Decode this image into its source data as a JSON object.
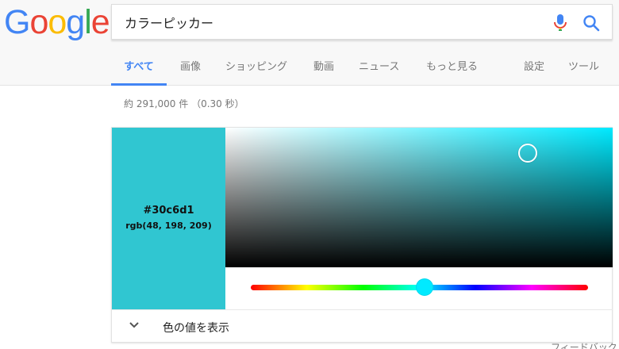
{
  "logo": {
    "letters": [
      "G",
      "o",
      "o",
      "g",
      "l",
      "e"
    ],
    "colors": [
      "#4285f4",
      "#ea4335",
      "#fbbc05",
      "#4285f4",
      "#34a853",
      "#ea4335"
    ]
  },
  "search": {
    "query": "カラーピッカー",
    "mic_icon": "microphone-icon",
    "search_icon": "magnifier-icon"
  },
  "tabs": [
    {
      "label": "すべて",
      "active": true
    },
    {
      "label": "画像",
      "active": false
    },
    {
      "label": "ショッピング",
      "active": false
    },
    {
      "label": "動画",
      "active": false
    },
    {
      "label": "ニュース",
      "active": false
    },
    {
      "label": "もっと見る",
      "active": false
    },
    {
      "label": "設定",
      "active": false
    },
    {
      "label": "ツール",
      "active": false
    }
  ],
  "result_stats": "約 291,000 件 （0.30 秒）",
  "color_picker": {
    "hex": "#30c6d1",
    "rgb": "rgb(48, 198, 209)",
    "hue_color": "#00eaff",
    "saturation": 0.78,
    "value": 0.82,
    "hue_fraction": 0.515,
    "expand_label": "色の値を表示",
    "expand_icon": "chevron-down-icon"
  },
  "feedback_label": "フィードバック",
  "colors": {
    "accent": "#4285f4",
    "swatch": "#30c6d1"
  }
}
